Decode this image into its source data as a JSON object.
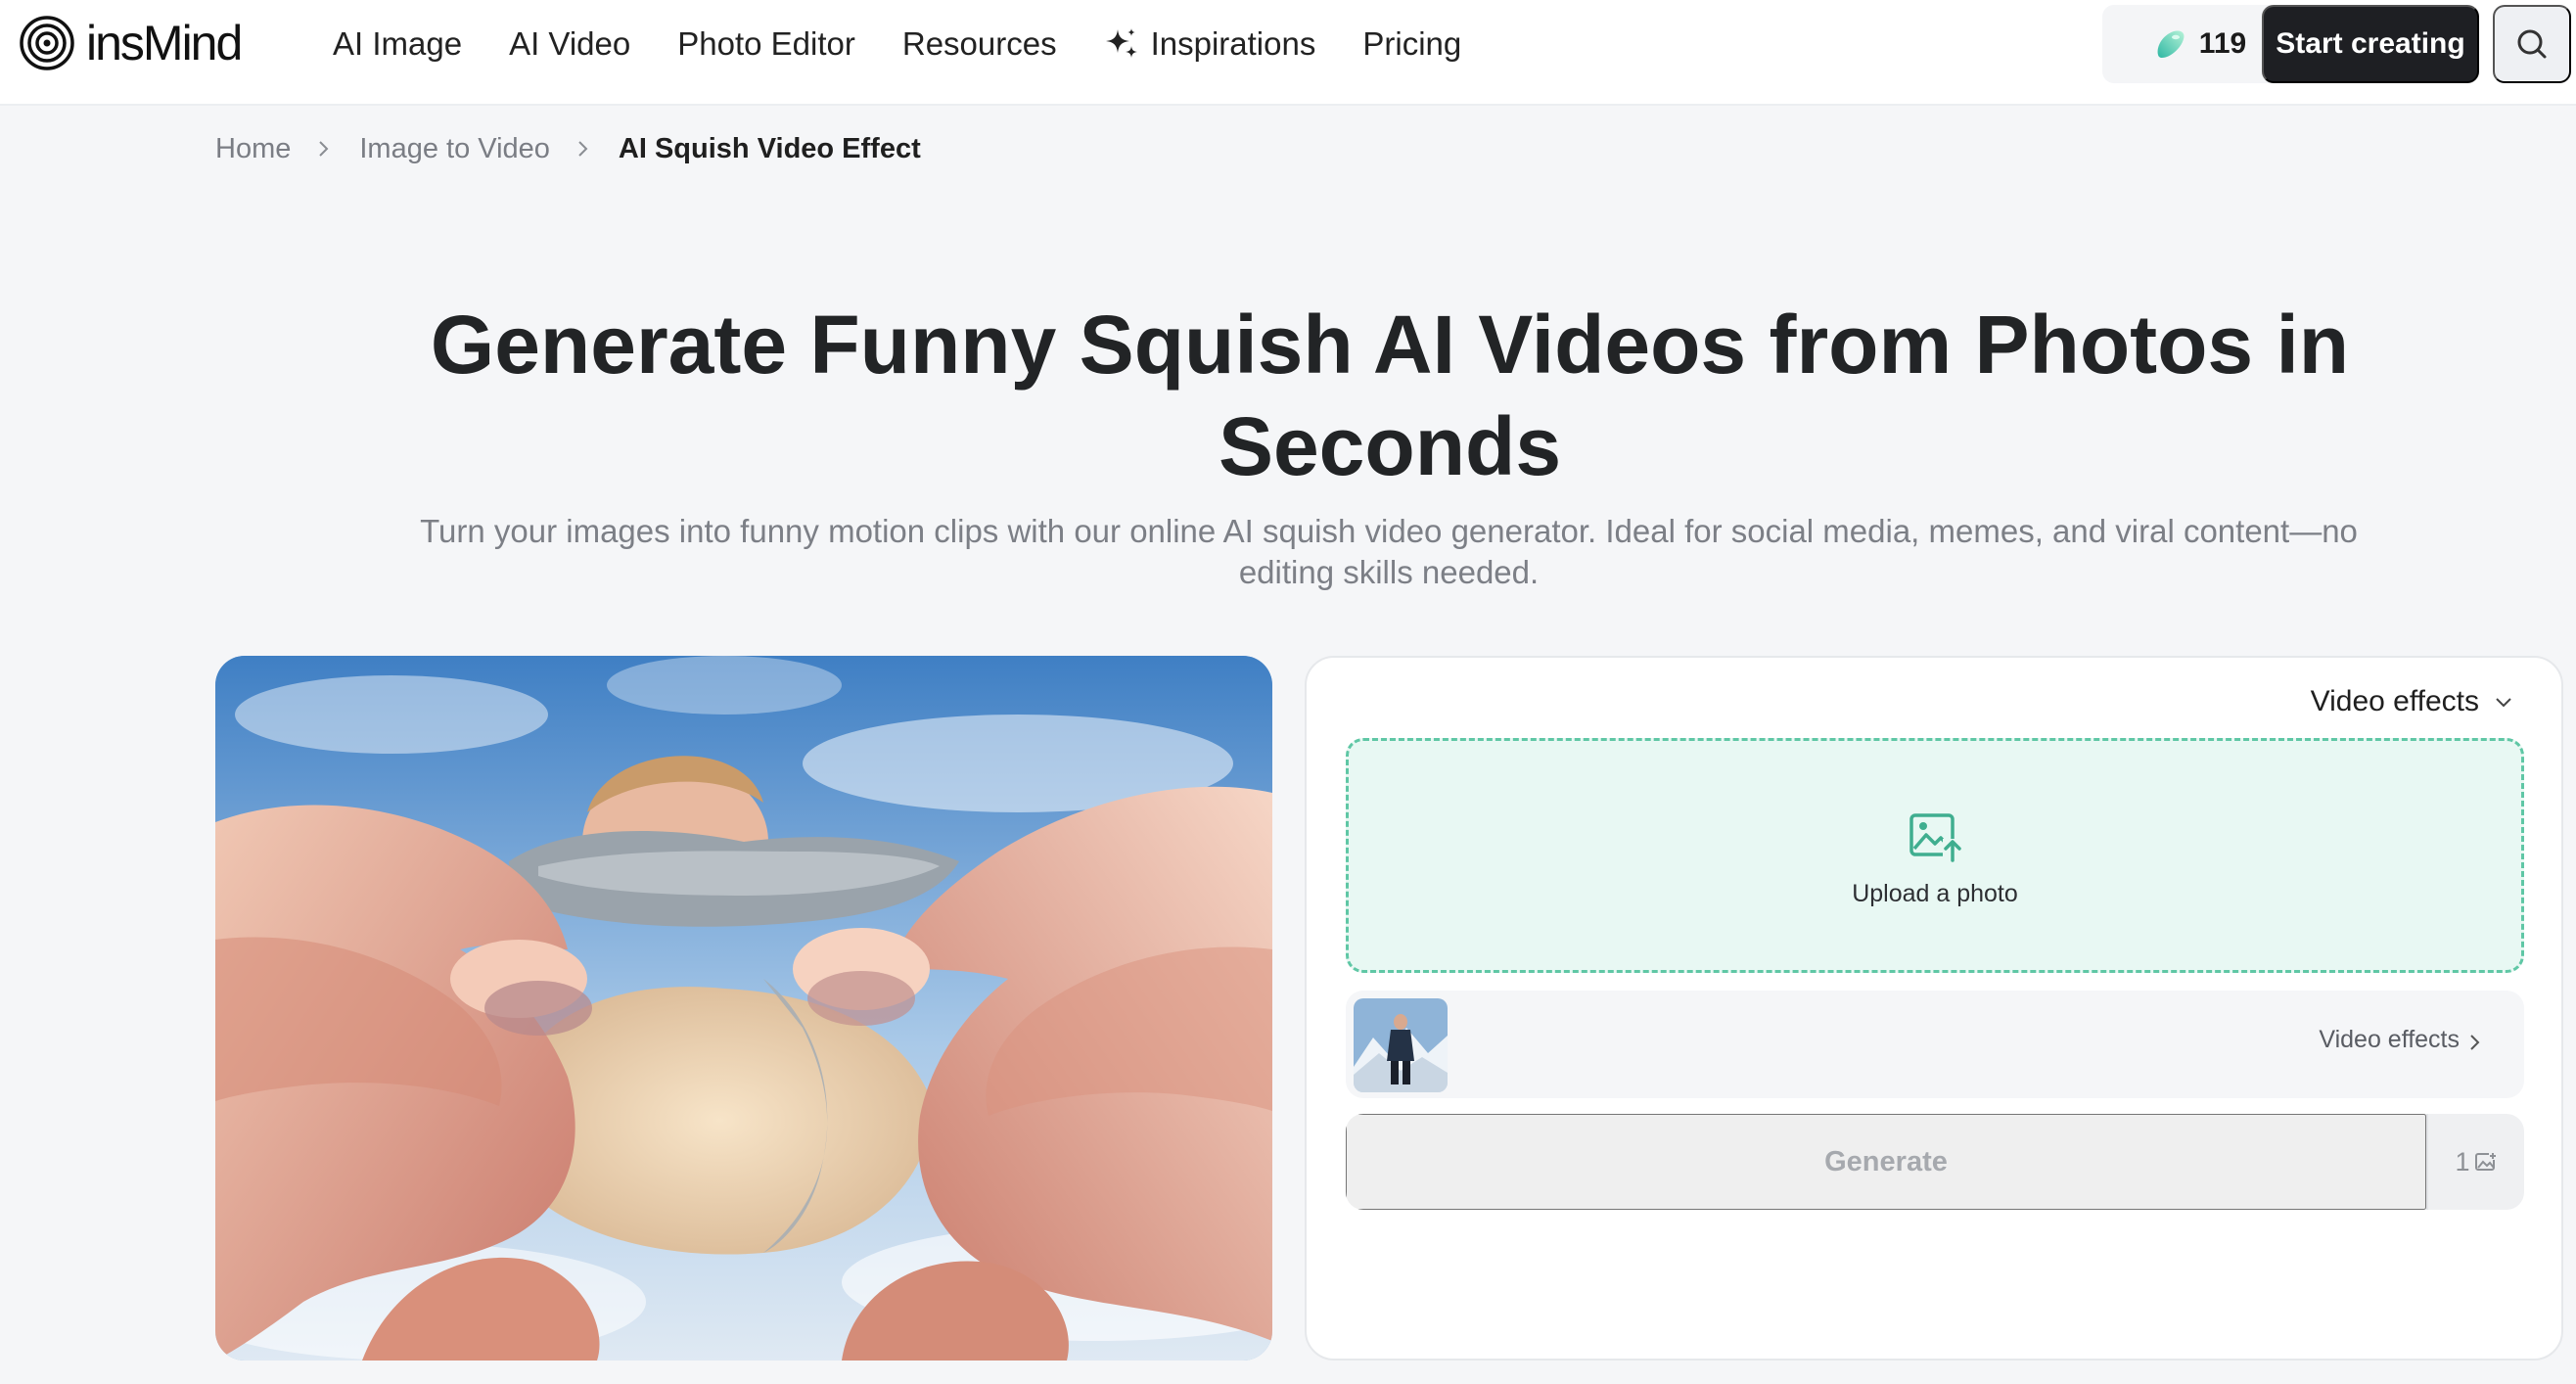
{
  "brand": {
    "name": "insMind"
  },
  "nav": {
    "items": [
      {
        "label": "AI Image"
      },
      {
        "label": "AI Video"
      },
      {
        "label": "Photo Editor"
      },
      {
        "label": "Resources"
      },
      {
        "label": "Inspirations",
        "icon": "sparkle-icon"
      },
      {
        "label": "Pricing"
      }
    ]
  },
  "header": {
    "credits": "119",
    "credits_icon": "gem-icon",
    "start_label": "Start creating",
    "search_icon": "search-icon"
  },
  "breadcrumb": {
    "home": "Home",
    "section": "Image to Video",
    "current": "AI Squish Video Effect"
  },
  "hero": {
    "title": "Generate Funny Squish AI Videos from Photos in Seconds",
    "subtitle": "Turn your images into funny motion clips with our online AI squish video generator. Ideal for social media, memes, and viral content—no editing skills needed."
  },
  "panel": {
    "dropdown_label": "Video effects",
    "upload_label": "Upload a photo",
    "effect_selector_label": "Video effects",
    "generate_label": "Generate",
    "generate_count": "1"
  },
  "colors": {
    "accent": "#5fc7a5",
    "upload_bg": "#e8f8f3",
    "dark_button": "#1e1f23"
  }
}
